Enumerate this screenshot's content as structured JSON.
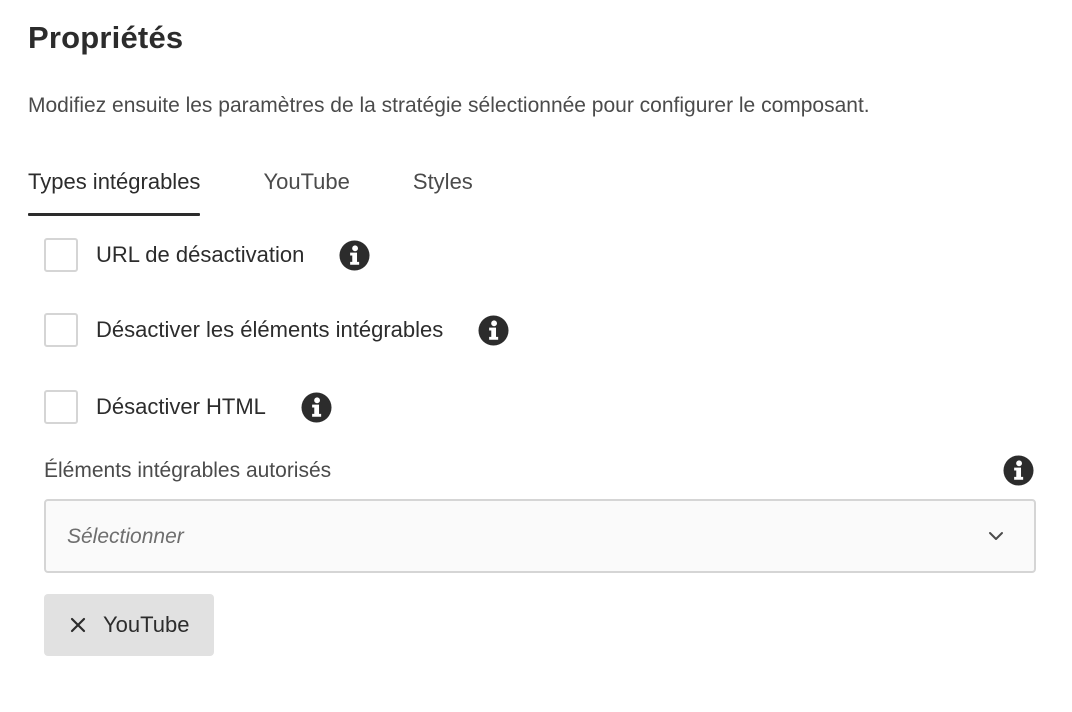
{
  "panel": {
    "title": "Propriétés",
    "description": "Modifiez ensuite les paramètres de la stratégie sélectionnée pour configurer le composant."
  },
  "tabs": [
    {
      "label": "Types intégrables",
      "selected": true
    },
    {
      "label": "YouTube",
      "selected": false
    },
    {
      "label": "Styles",
      "selected": false
    }
  ],
  "checkboxes": [
    {
      "label": "URL de désactivation",
      "checked": false,
      "icon": "info-icon"
    },
    {
      "label": "Désactiver les éléments intégrables",
      "checked": false,
      "icon": "info-icon"
    },
    {
      "label": "Désactiver HTML",
      "checked": false,
      "icon": "info-icon"
    }
  ],
  "allowed_embeddables": {
    "label": "Éléments intégrables autorisés",
    "placeholder": "Sélectionner",
    "icon": "chevron-down-icon",
    "tags": [
      {
        "label": "YouTube",
        "remove_icon": "close-icon"
      }
    ]
  },
  "colors": {
    "text": "#2c2c2c",
    "secondary_text": "#4b4b4b",
    "border": "#d5d5d5",
    "tag_background": "#e1e1e1"
  }
}
